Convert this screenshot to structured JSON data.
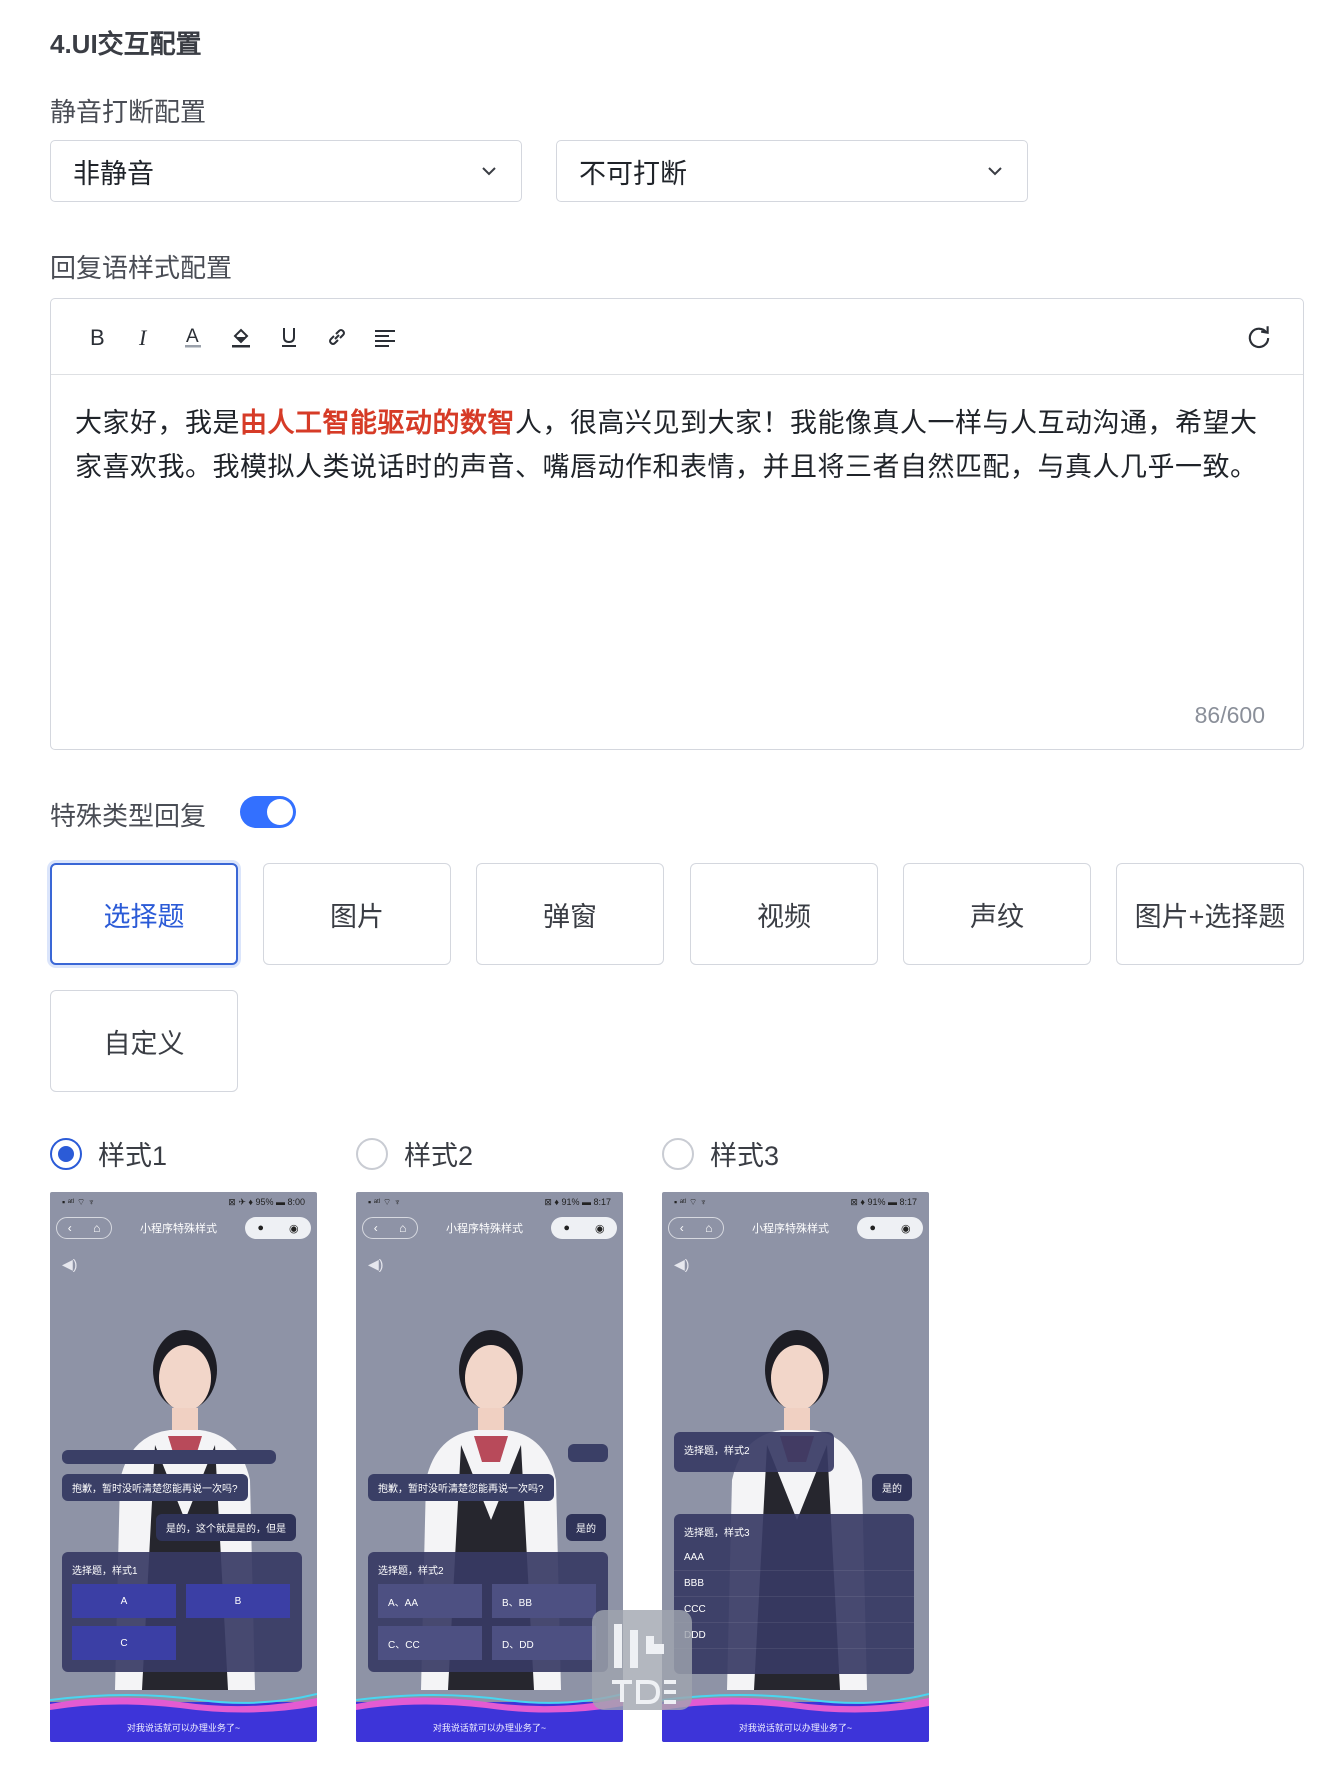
{
  "section_title": "4.UI交互配置",
  "mute": {
    "label": "静音打断配置",
    "mute_value": "非静音",
    "interrupt_value": "不可打断"
  },
  "reply_style": {
    "label": "回复语样式配置",
    "toolbar": [
      "bold-icon",
      "italic-icon",
      "font-color-icon",
      "highlight-icon",
      "underline-icon",
      "link-icon",
      "align-icon"
    ],
    "refresh": "refresh-icon",
    "text_before": "大家好，我是",
    "text_highlight": "由人工智能驱动的数智",
    "text_after": "人，很高兴见到大家！我能像真人一样与人互动沟通，希望大家喜欢我。我模拟人类说话时的声音、嘴唇动作和表情，并且将三者自然匹配，与真人几乎一致。",
    "highlight_color": "#d63b27",
    "counter": "86/600"
  },
  "special_reply": {
    "label": "特殊类型回复",
    "enabled": true,
    "types": [
      "选择题",
      "图片",
      "弹窗",
      "视频",
      "声纹",
      "图片+选择题",
      "自定义"
    ],
    "selected_type": "选择题"
  },
  "styles": [
    {
      "label": "样式1",
      "selected": true,
      "status_left": "▪︎ ᵃᵗˡ ⌔ ♆",
      "status_right": "⊠ ✈ ♦ 95% ▬ 8:00",
      "nav_title": "小程序特殊样式",
      "bubble_top": "",
      "bubble_q": "抱歉，暂时没听清楚您能再说一次吗?",
      "bubble_a": "是的，这个就是是的，但是",
      "panel_title": "选择题，样式1",
      "choices": [
        "A",
        "B",
        "C"
      ],
      "footer": "对我说话就可以办理业务了~"
    },
    {
      "label": "样式2",
      "selected": false,
      "status_left": "▪︎ ᵃᵗˡ ⌔ ♆",
      "status_right": "⊠ ♦ 91% ▬ 8:17",
      "nav_title": "小程序特殊样式",
      "bubble_q": "抱歉，暂时没听清楚您能再说一次吗?",
      "bubble_a": "是的",
      "panel_title": "选择题，样式2",
      "choices": [
        "A、AA",
        "B、BB",
        "C、CC",
        "D、DD"
      ],
      "footer": "对我说话就可以办理业务了~"
    },
    {
      "label": "样式3",
      "selected": false,
      "status_left": "▪︎ ᵃᵗˡ ⌔ ♆",
      "status_right": "⊠ ♦ 91% ▬ 8:17",
      "nav_title": "小程序特殊样式",
      "panel_top_title": "选择题，样式2",
      "bubble_a": "是的",
      "panel_title": "选择题，样式3",
      "choices": [
        "AAA",
        "BBB",
        "CCC",
        "DDD"
      ],
      "footer": "对我说话就可以办理业务了~"
    }
  ],
  "colors": {
    "accent": "#3370ff",
    "phone_bg": "#8e93a6",
    "panel": "#373a64"
  }
}
